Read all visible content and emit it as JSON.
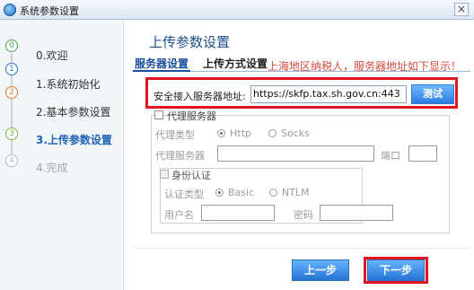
{
  "window": {
    "title": "系统参数设置",
    "close_label": "×"
  },
  "steps": [
    {
      "label": "0.欢迎",
      "icon": "0"
    },
    {
      "label": "1.系统初始化",
      "icon": "1"
    },
    {
      "label": "2.基本参数设置",
      "icon": "2"
    },
    {
      "label": "3.上传参数设置",
      "icon": "3"
    },
    {
      "label": "4.完成",
      "icon": "4"
    }
  ],
  "main": {
    "heading": "上传参数设置",
    "tabs": [
      {
        "label": "服务器设置"
      },
      {
        "label": "上传方式设置"
      }
    ],
    "notice": "上海地区纳税人，服务器地址如下显示！",
    "server": {
      "label": "安全接入服务器地址:",
      "value": "https://skfp.tax.sh.gov.cn:443",
      "test_label": "测试"
    },
    "proxy": {
      "enable_label": "代理服务器",
      "type_label": "代理类型",
      "http_label": "Http",
      "socks_label": "Socks",
      "server_label": "代理服务器",
      "port_label": "端口",
      "auth": {
        "title": "身份认证",
        "type_label": "认证类型",
        "basic_label": "Basic",
        "ntlm_label": "NTLM",
        "user_label": "用户名",
        "password_label": "密码"
      }
    }
  },
  "buttons": {
    "prev_label": "上一步",
    "next_label": "下一步"
  },
  "colors": {
    "highlight": "#e2141f",
    "button": "#2b7de1",
    "title": "#1f4f8a"
  }
}
